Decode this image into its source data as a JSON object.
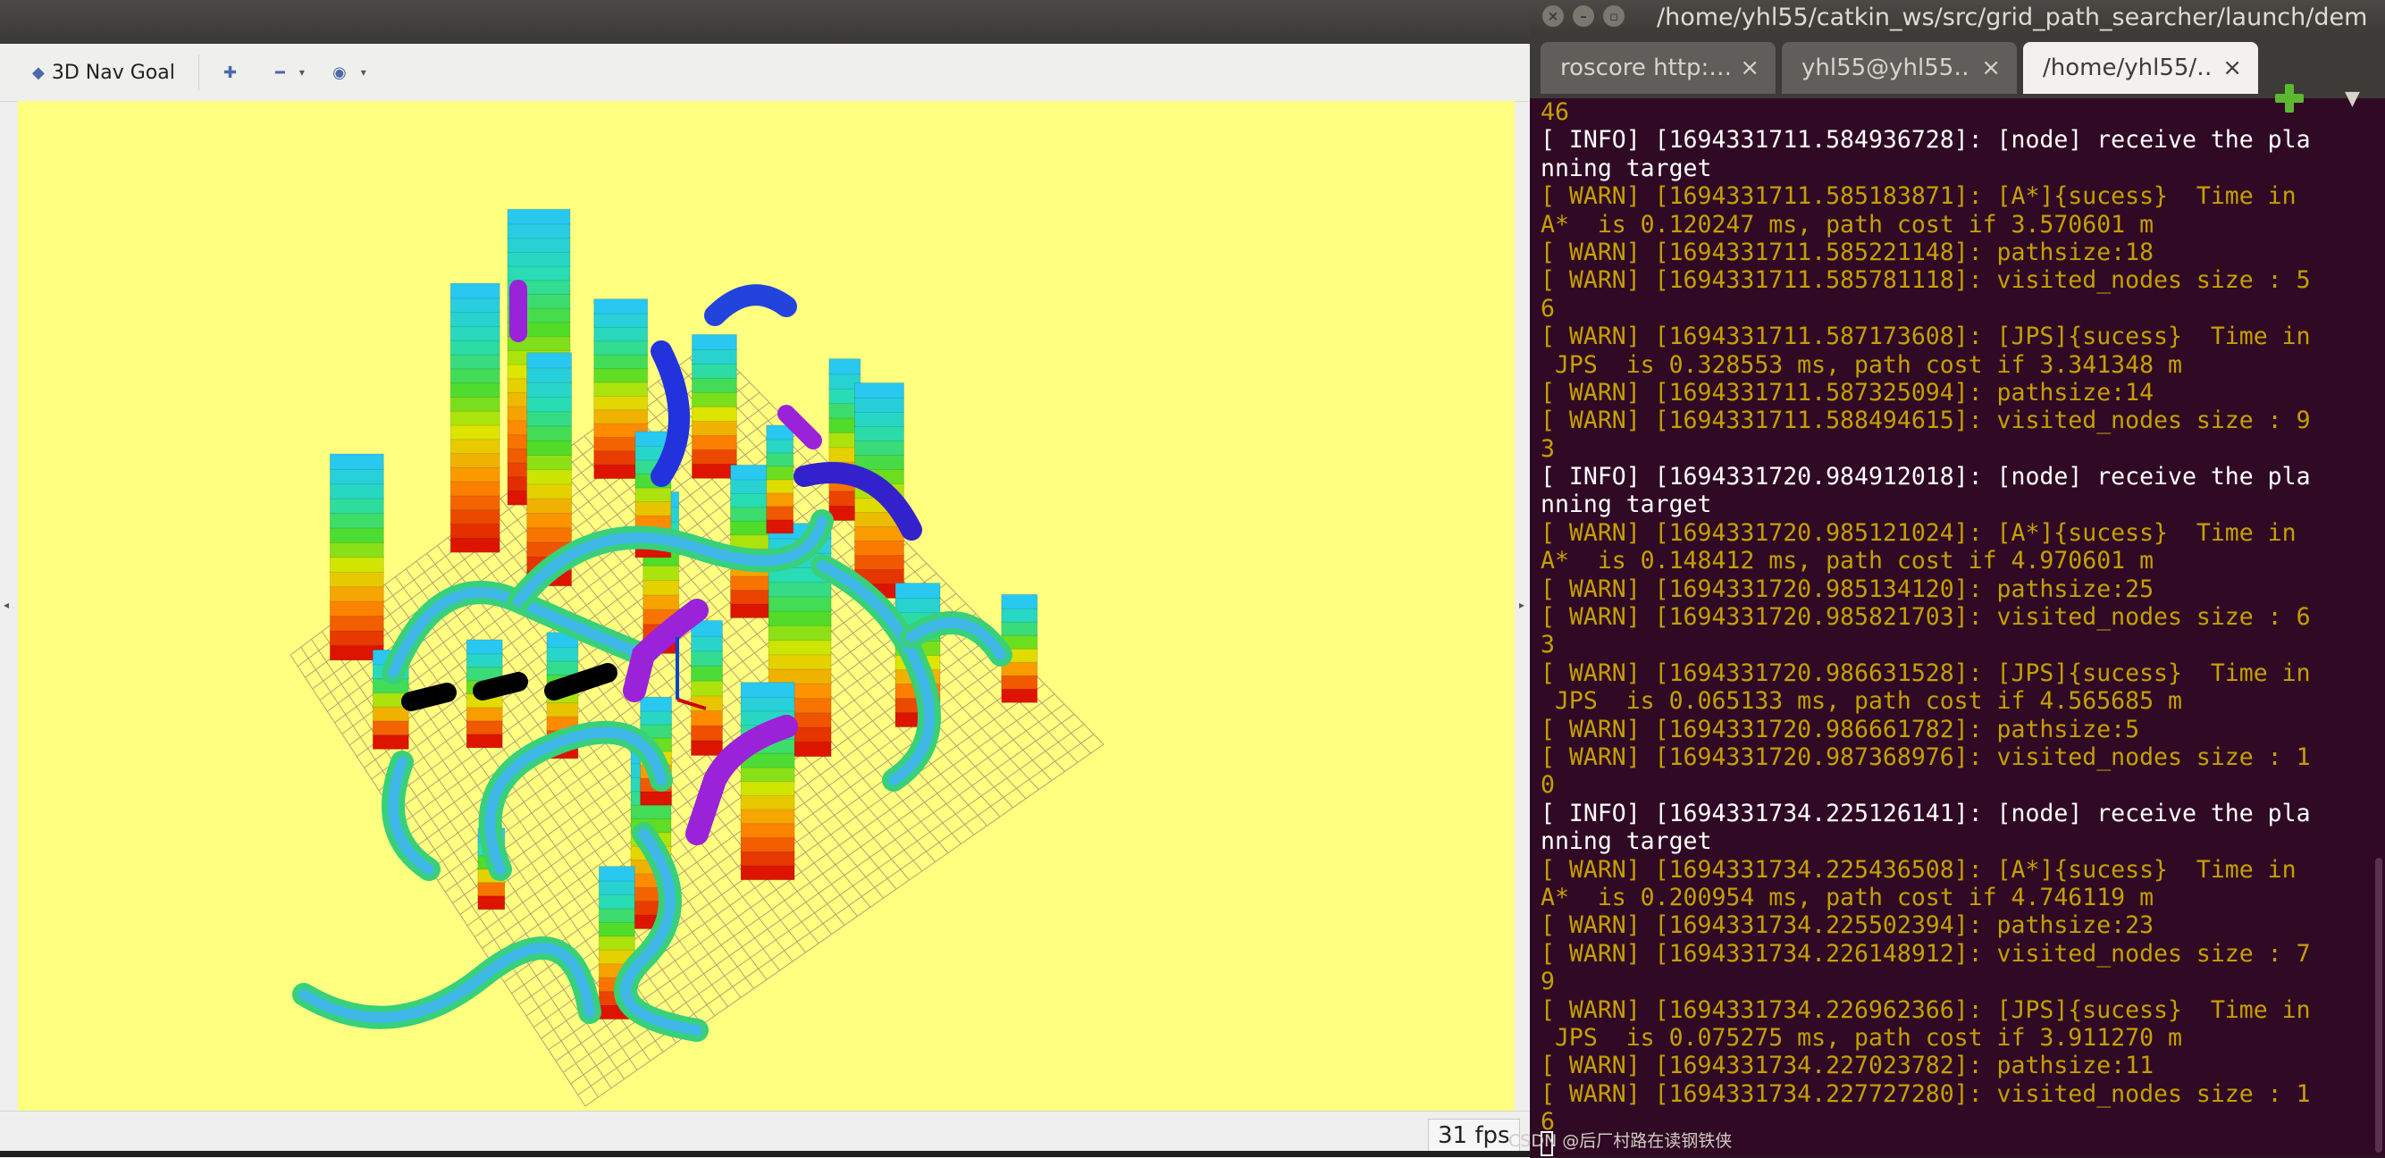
{
  "rviz": {
    "toolbar": {
      "nav_goal_label": "3D Nav Goal",
      "zoom_in_glyph": "✚",
      "zoom_out_glyph": "━",
      "view_glyph": "◉",
      "dropdown_glyph": "▾"
    },
    "viewport": {
      "background_color": "#ffff80",
      "left_collapse_glyph": "◂",
      "right_collapse_glyph": "▸"
    },
    "status": {
      "fps": "31 fps"
    }
  },
  "terminal": {
    "window_title": "/home/yhl55/catkin_ws/src/grid_path_searcher/launch/dem",
    "window_buttons": [
      "×",
      "–",
      "▫"
    ],
    "tabs": [
      {
        "label": "roscore http:…",
        "close": "×",
        "active": false
      },
      {
        "label": "yhl55@yhl55…",
        "close": "×",
        "active": false
      },
      {
        "label": "/home/yhl55/…",
        "close": "×",
        "active": true
      }
    ],
    "menu_glyph": "▼",
    "lines": [
      {
        "text": "46",
        "kind": "warn"
      },
      {
        "text": "[ INFO] [1694331711.584936728]: [node] receive the pla",
        "kind": "info"
      },
      {
        "text": "nning target",
        "kind": "info"
      },
      {
        "text": "[ WARN] [1694331711.585183871]: [A*]{sucess}  Time in",
        "kind": "warn"
      },
      {
        "text": "A*  is 0.120247 ms, path cost if 3.570601 m",
        "kind": "warn"
      },
      {
        "text": "[ WARN] [1694331711.585221148]: pathsize:18",
        "kind": "warn"
      },
      {
        "text": "[ WARN] [1694331711.585781118]: visited_nodes size : 5",
        "kind": "warn"
      },
      {
        "text": "6",
        "kind": "warn"
      },
      {
        "text": "[ WARN] [1694331711.587173608]: [JPS]{sucess}  Time in",
        "kind": "warn"
      },
      {
        "text": " JPS  is 0.328553 ms, path cost if 3.341348 m",
        "kind": "warn"
      },
      {
        "text": "[ WARN] [1694331711.587325094]: pathsize:14",
        "kind": "warn"
      },
      {
        "text": "[ WARN] [1694331711.588494615]: visited_nodes size : 9",
        "kind": "warn"
      },
      {
        "text": "3",
        "kind": "warn"
      },
      {
        "text": "[ INFO] [1694331720.984912018]: [node] receive the pla",
        "kind": "info"
      },
      {
        "text": "nning target",
        "kind": "info"
      },
      {
        "text": "[ WARN] [1694331720.985121024]: [A*]{sucess}  Time in",
        "kind": "warn"
      },
      {
        "text": "A*  is 0.148412 ms, path cost if 4.970601 m",
        "kind": "warn"
      },
      {
        "text": "[ WARN] [1694331720.985134120]: pathsize:25",
        "kind": "warn"
      },
      {
        "text": "[ WARN] [1694331720.985821703]: visited_nodes size : 6",
        "kind": "warn"
      },
      {
        "text": "3",
        "kind": "warn"
      },
      {
        "text": "[ WARN] [1694331720.986631528]: [JPS]{sucess}  Time in",
        "kind": "warn"
      },
      {
        "text": " JPS  is 0.065133 ms, path cost if 4.565685 m",
        "kind": "warn"
      },
      {
        "text": "[ WARN] [1694331720.986661782]: pathsize:5",
        "kind": "warn"
      },
      {
        "text": "[ WARN] [1694331720.987368976]: visited_nodes size : 1",
        "kind": "warn"
      },
      {
        "text": "0",
        "kind": "warn"
      },
      {
        "text": "[ INFO] [1694331734.225126141]: [node] receive the pla",
        "kind": "info"
      },
      {
        "text": "nning target",
        "kind": "info"
      },
      {
        "text": "[ WARN] [1694331734.225436508]: [A*]{sucess}  Time in",
        "kind": "warn"
      },
      {
        "text": "A*  is 0.200954 ms, path cost if 4.746119 m",
        "kind": "warn"
      },
      {
        "text": "[ WARN] [1694331734.225502394]: pathsize:23",
        "kind": "warn"
      },
      {
        "text": "[ WARN] [1694331734.226148912]: visited_nodes size : 7",
        "kind": "warn"
      },
      {
        "text": "9",
        "kind": "warn"
      },
      {
        "text": "[ WARN] [1694331734.226962366]: [JPS]{sucess}  Time in",
        "kind": "warn"
      },
      {
        "text": " JPS  is 0.075275 ms, path cost if 3.911270 m",
        "kind": "warn"
      },
      {
        "text": "[ WARN] [1694331734.227023782]: pathsize:11",
        "kind": "warn"
      },
      {
        "text": "[ WARN] [1694331734.227727280]: visited_nodes size : 1",
        "kind": "warn"
      },
      {
        "text": "6",
        "kind": "warn"
      }
    ],
    "colors": {
      "background": "#300a24",
      "warn": "#c4a000",
      "info": "#ffffff"
    }
  },
  "watermark": "CSDN @后厂村路在读钢铁侠"
}
